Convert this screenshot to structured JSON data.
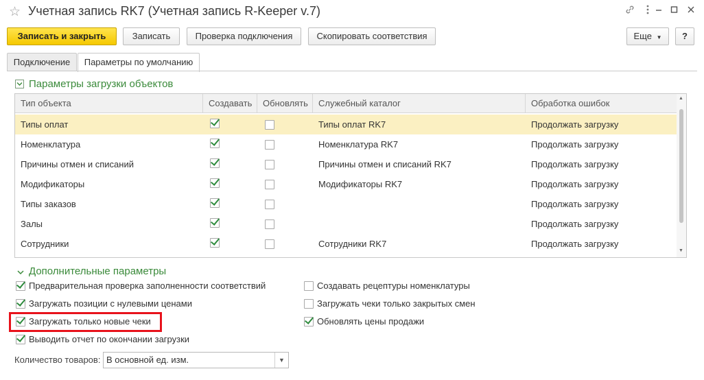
{
  "window": {
    "title": "Учетная запись RK7 (Учетная запись R-Keeper v.7)",
    "icons": [
      "star-icon",
      "link-icon",
      "more-icon",
      "minimize-icon",
      "maximize-icon",
      "close-icon"
    ]
  },
  "toolbar": {
    "save_close": "Записать и закрыть",
    "save": "Записать",
    "check_connection": "Проверка подключения",
    "copy_mappings": "Скопировать соответствия",
    "more": "Еще",
    "help": "?"
  },
  "tabs": [
    {
      "label": "Подключение",
      "active": false
    },
    {
      "label": "Параметры по умолчанию",
      "active": true
    }
  ],
  "objects_section": {
    "title": "Параметры загрузки объектов",
    "columns": [
      "Тип объекта",
      "Создавать",
      "Обновлять",
      "Служебный каталог",
      "Обработка ошибок"
    ],
    "rows": [
      {
        "type": "Типы оплат",
        "create": true,
        "update": false,
        "catalog": "Типы оплат RK7",
        "errors": "Продолжать загрузку",
        "selected": true
      },
      {
        "type": "Номенклатура",
        "create": true,
        "update": false,
        "catalog": "Номенклатура RK7",
        "errors": "Продолжать загрузку"
      },
      {
        "type": "Причины отмен и списаний",
        "create": true,
        "update": false,
        "catalog": "Причины отмен и списаний RK7",
        "errors": "Продолжать загрузку"
      },
      {
        "type": "Модификаторы",
        "create": true,
        "update": false,
        "catalog": "Модификаторы RK7",
        "errors": "Продолжать загрузку"
      },
      {
        "type": "Типы заказов",
        "create": true,
        "update": false,
        "catalog": "",
        "errors": "Продолжать загрузку"
      },
      {
        "type": "Залы",
        "create": true,
        "update": false,
        "catalog": "",
        "errors": "Продолжать загрузку"
      },
      {
        "type": "Сотрудники",
        "create": true,
        "update": false,
        "catalog": "Сотрудники RK7",
        "errors": "Продолжать загрузку"
      }
    ]
  },
  "extra_section": {
    "title": "Дополнительные параметры",
    "left_options": [
      {
        "label": "Предварительная проверка заполненности соответствий",
        "checked": true
      },
      {
        "label": "Загружать позиции с нулевыми ценами",
        "checked": true
      },
      {
        "label": "Загружать только новые чеки",
        "checked": true
      },
      {
        "label": "Выводить отчет по окончании загрузки",
        "checked": true
      }
    ],
    "right_options": [
      {
        "label": "Создавать рецептуры номенклатуры",
        "checked": false
      },
      {
        "label": "Загружать чеки только закрытых смен",
        "checked": false
      },
      {
        "label": "Обновлять цены продажи",
        "checked": true
      }
    ],
    "quantity_label": "Количество товаров:",
    "quantity_value": "В основной ед. изм."
  },
  "colors": {
    "primary_button": "#f5c800",
    "section_title": "#3a8a3a",
    "selected_row": "#fbf0c2",
    "highlight_border": "#e8121b",
    "check_mark": "#2e8b3d"
  }
}
